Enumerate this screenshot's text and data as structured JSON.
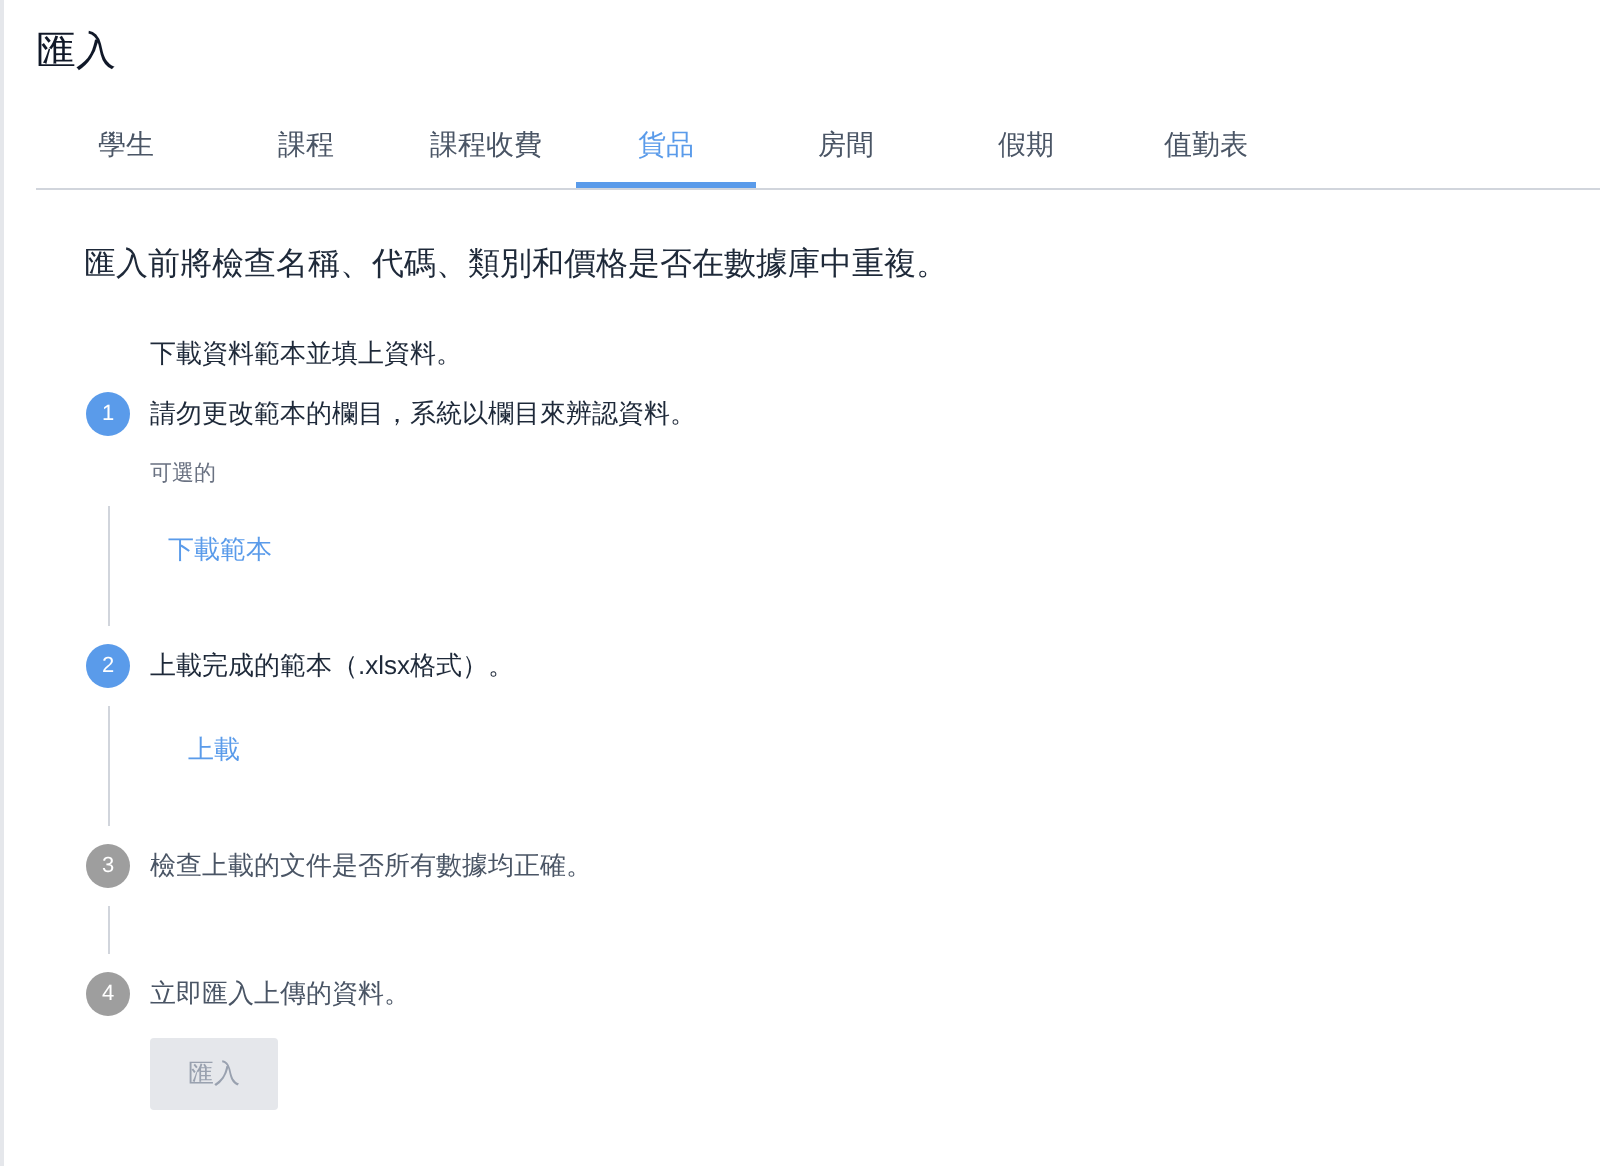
{
  "title": "匯入",
  "tabs": [
    {
      "label": "學生",
      "selected": false
    },
    {
      "label": "課程",
      "selected": false
    },
    {
      "label": "課程收費",
      "selected": false
    },
    {
      "label": "貨品",
      "selected": true
    },
    {
      "label": "房間",
      "selected": false
    },
    {
      "label": "假期",
      "selected": false
    },
    {
      "label": "值勤表",
      "selected": false
    }
  ],
  "description": "匯入前將檢查名稱、代碼、類別和價格是否在數據庫中重複。",
  "steps": [
    {
      "number": "1",
      "active": true,
      "intro": "下載資料範本並填上資料。",
      "text": "請勿更改範本的欄目，系統以欄目來辨認資料。",
      "optional_label": "可選的",
      "link": "下載範本"
    },
    {
      "number": "2",
      "active": true,
      "text": "上載完成的範本（.xlsx格式）。",
      "link": "上載"
    },
    {
      "number": "3",
      "active": false,
      "text": "檢查上載的文件是否所有數據均正確。"
    },
    {
      "number": "4",
      "active": false,
      "text": "立即匯入上傳的資料。",
      "button": {
        "label": "匯入",
        "disabled": true
      }
    }
  ]
}
